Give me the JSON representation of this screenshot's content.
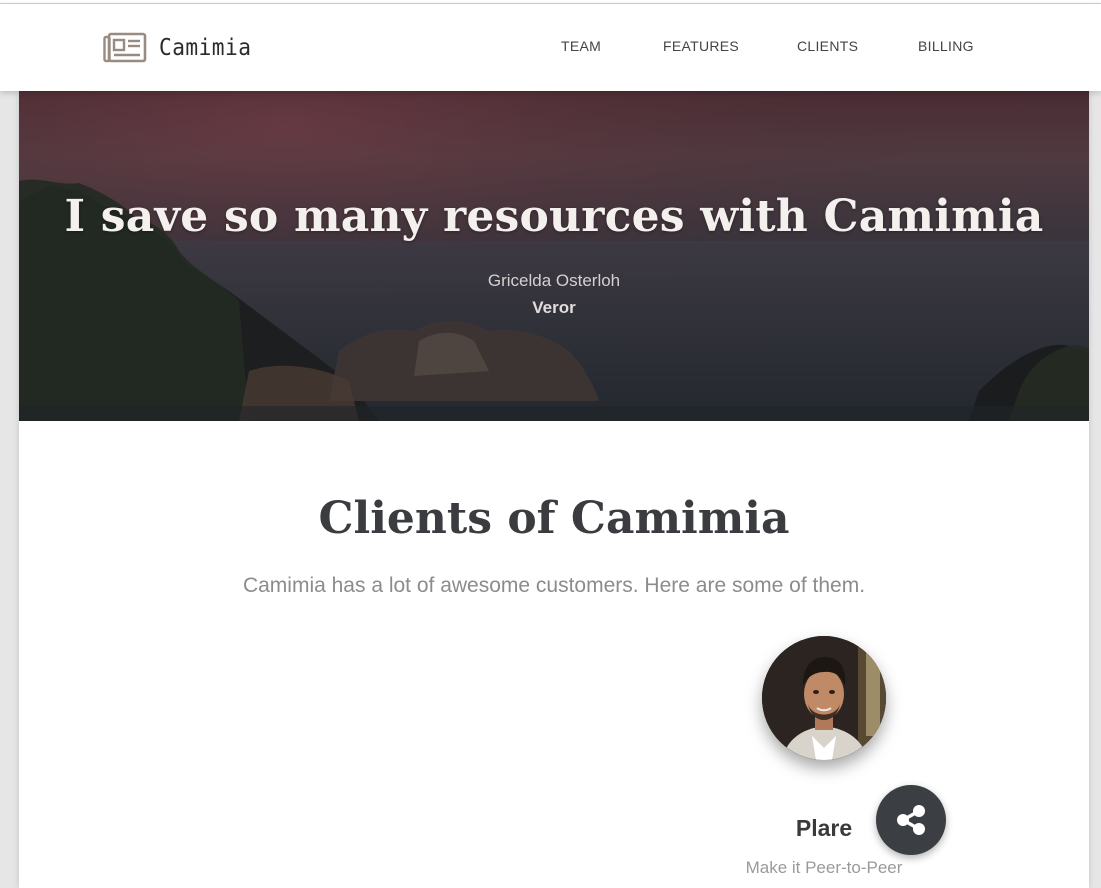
{
  "brand": {
    "name": "Camimia",
    "icon": "newspaper-icon"
  },
  "nav": {
    "items": [
      "TEAM",
      "FEATURES",
      "CLIENTS",
      "BILLING"
    ]
  },
  "hero": {
    "quote": "I save so many resources with Camimia",
    "author": "Gricelda Osterloh",
    "company": "Veror"
  },
  "clients": {
    "title": "Clients of Camimia",
    "subtitle": "Camimia has a lot of awesome customers. Here are some of them.",
    "items": [
      {
        "name": "Plare",
        "tagline": "Make it Peer-to-Peer"
      }
    ]
  },
  "share": {
    "icon": "share-icon"
  },
  "colors": {
    "dark": "#3b3e42",
    "heading": "#3a3c40",
    "muted": "#8c8c8c"
  }
}
